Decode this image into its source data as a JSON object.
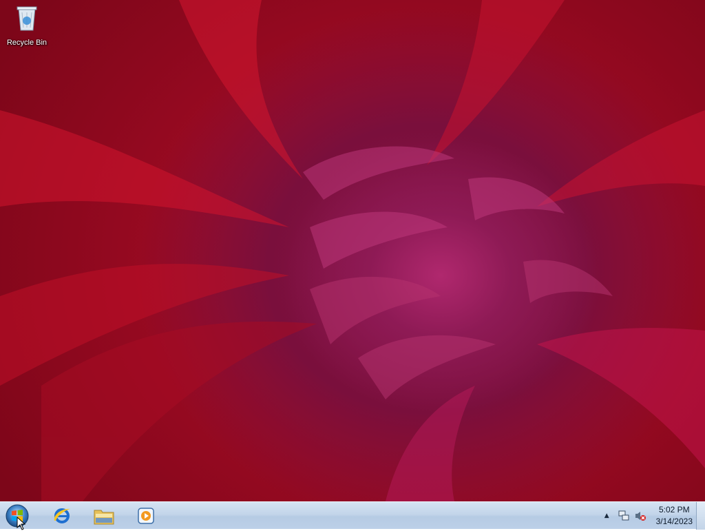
{
  "desktop": {
    "icons": [
      {
        "label": "Recycle Bin",
        "icon": "recycle-bin-icon"
      }
    ]
  },
  "taskbar": {
    "start_icon": "windows-start-orb-icon",
    "pinned": [
      {
        "name": "Internet Explorer",
        "icon": "internet-explorer-icon"
      },
      {
        "name": "Windows Explorer",
        "icon": "file-explorer-icon"
      },
      {
        "name": "Windows Media Player",
        "icon": "media-player-icon"
      }
    ],
    "tray": {
      "show_hidden_icon": "chevron-up-icon",
      "network_icon": "network-icon",
      "volume_icon": "volume-muted-icon",
      "time": "5:02 PM",
      "date": "3/14/2023"
    }
  },
  "colors": {
    "taskbar_bg": "#c3d5ea",
    "wallpaper_red": "#b3102a",
    "wallpaper_magenta": "#8e1a55"
  }
}
